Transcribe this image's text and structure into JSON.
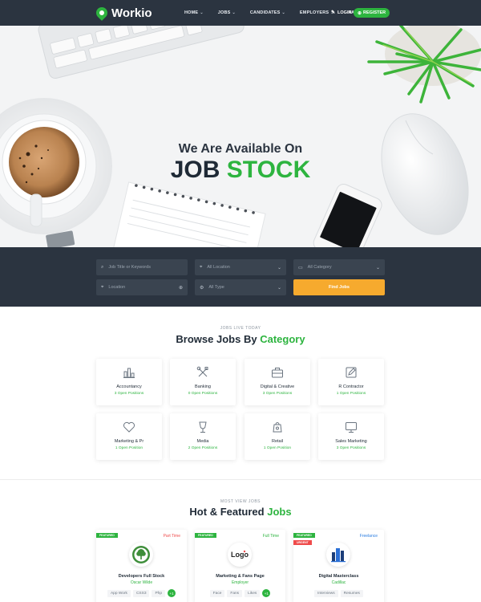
{
  "nav": {
    "brand": "Workio",
    "items": [
      {
        "label": "HOME"
      },
      {
        "label": "JOBS"
      },
      {
        "label": "CANDIDATES"
      },
      {
        "label": "EMPLOYERS"
      },
      {
        "label": "PAGES"
      }
    ],
    "login": "LOGIN",
    "register": "REGISTER"
  },
  "hero": {
    "subtitle": "We Are Available On",
    "title_part1": "JOB",
    "title_part2": "STOCK"
  },
  "search": {
    "keywords_placeholder": "Job Title or Keywords",
    "location_select": "All Location",
    "category_select": "All Category",
    "location_placeholder": "Location",
    "type_select": "All Type",
    "find_button": "Find Jobs"
  },
  "categories_section": {
    "eyebrow": "JOBS LIVE TODAY",
    "title_part1": "Browse Jobs By",
    "title_part2": "Category",
    "items": [
      {
        "name": "Accountancy",
        "count": "3 Open Positions",
        "icon": "bar-chart-icon"
      },
      {
        "name": "Banking",
        "count": "0 Open Positions",
        "icon": "tools-icon"
      },
      {
        "name": "Digital & Creative",
        "count": "3 Open Positions",
        "icon": "briefcase-icon"
      },
      {
        "name": "R Contractor",
        "count": "1 Open Positions",
        "icon": "edit-icon"
      },
      {
        "name": "Marketing & Pr",
        "count": "1 Open Position",
        "icon": "heart-icon"
      },
      {
        "name": "Media",
        "count": "2 Open Positions",
        "icon": "glass-icon"
      },
      {
        "name": "Retail",
        "count": "1 Open Position",
        "icon": "cart-icon"
      },
      {
        "name": "Sales Marketing",
        "count": "3 Open Positions",
        "icon": "monitor-icon"
      }
    ]
  },
  "jobs_section": {
    "eyebrow": "MOST VIEW JOBS",
    "title_part1": "Hot & Featured",
    "title_part2": "Jobs",
    "jobs": [
      {
        "badge": "FEATURED",
        "type": "Part Time",
        "type_color": "#ef4b4b",
        "title": "Developers Full Stock",
        "company": "Oscar Wilde",
        "tags": [
          "App Work",
          "CSS3",
          "Php"
        ],
        "more": "+1",
        "logo": "tree-logo-icon"
      },
      {
        "badge": "FEATURED",
        "type": "Full Time",
        "type_color": "#2db43f",
        "title": "Marketing & Fans Page",
        "company": "Employer",
        "tags": [
          "Face",
          "Fans",
          "Likes"
        ],
        "more": "+1",
        "logo": "logo-text-icon",
        "logo_text": "Logo"
      },
      {
        "badge": "FEATURED",
        "urgent": "URGENT",
        "type": "Freelance",
        "type_color": "#2a7de1",
        "title": "Digital Masterclass",
        "company": "Cadillac",
        "tags": [
          "Interviews",
          "Resumes"
        ],
        "logo": "buildings-logo-icon"
      }
    ]
  }
}
